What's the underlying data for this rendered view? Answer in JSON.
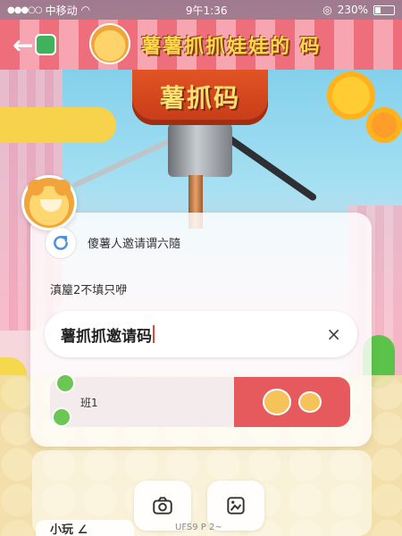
{
  "status_bar": {
    "carrier": "中移动",
    "time": "9午1:36",
    "battery_percent": "230%"
  },
  "header": {
    "back_glyph": "←",
    "title": "薯薯抓抓娃娃的 码"
  },
  "machine": {
    "label": "薯抓码"
  },
  "invite": {
    "invited_by": "傻薯人邀请谓六隨",
    "fill_hint": "滇箼2不填只咿",
    "code_value": "薯抓抓邀请码",
    "clear_glyph": "×"
  },
  "team_card": {
    "name": "班1"
  },
  "bottom": {
    "label": "小玩 ∠",
    "watermark": "UFS9 P 2~"
  },
  "colors": {
    "header_stripe_a": "#ef6e7c",
    "header_stripe_b": "#f7a5b0",
    "title_yellow": "#ffd84a",
    "machine_orange": "#e25525",
    "team_red": "#e65a5e"
  },
  "icons": {
    "back": "back-arrow-icon",
    "refresh": "refresh-icon",
    "clear": "close-icon",
    "camera": "camera-icon",
    "album": "album-icon"
  }
}
